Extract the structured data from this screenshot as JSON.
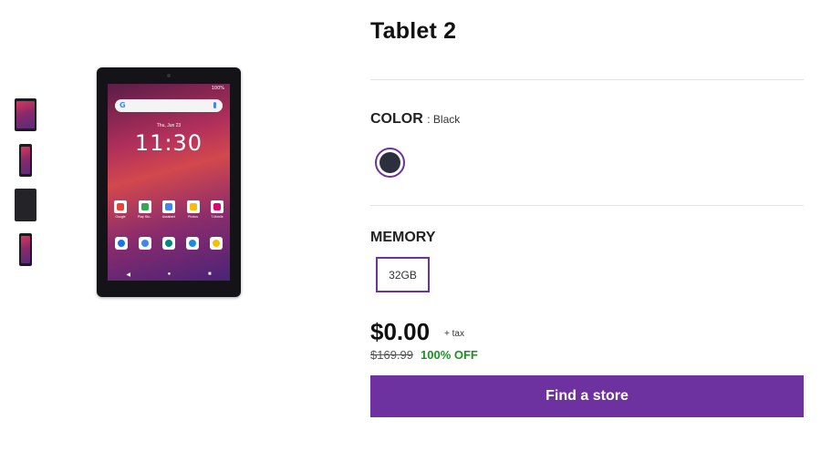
{
  "product": {
    "title": "Tablet 2"
  },
  "color": {
    "label": "COLOR",
    "value_text": ": Black",
    "swatches": [
      {
        "name": "Black",
        "hex": "#2d2f3e",
        "selected": true
      }
    ]
  },
  "memory": {
    "label": "MEMORY",
    "options": [
      {
        "label": "32GB",
        "selected": true
      }
    ]
  },
  "pricing": {
    "price": "$0.00",
    "tax_note": "+ tax",
    "original_price": "$169.99",
    "discount": "100% OFF"
  },
  "cta": {
    "label": "Find a store"
  },
  "device_screen": {
    "status": "100%",
    "date": "Thu, Jun 23",
    "time": "11:30",
    "apps": [
      "Google",
      "Play Sto..",
      "Assistant",
      "Photos",
      "T-Mobile"
    ],
    "nav": [
      "◀",
      "●",
      "■"
    ]
  },
  "colors": {
    "accent": "#6e32a0",
    "discount_green": "#17951c",
    "divider": "#e3e3e3"
  },
  "gallery": {
    "thumbnails": [
      "front-view",
      "angle-view",
      "back-view",
      "side-view"
    ]
  }
}
